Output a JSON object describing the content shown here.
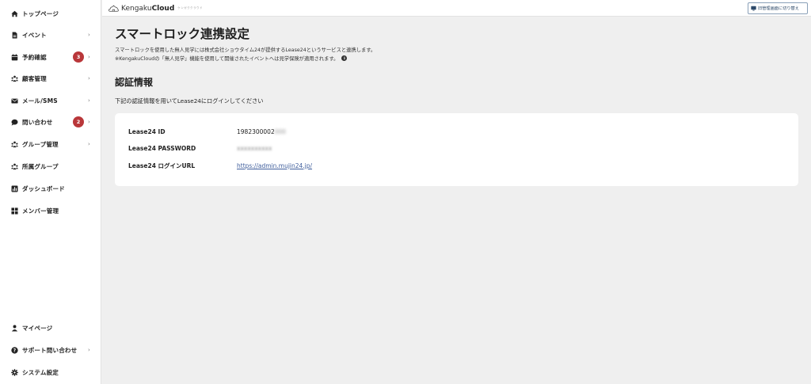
{
  "header": {
    "logo_light": "Kengaku",
    "logo_bold": "Cloud",
    "logo_sub": "ケンガククラウド",
    "switch_label": "旧管理画面に切り替え"
  },
  "sidebar": {
    "items": [
      {
        "label": "トップページ",
        "icon": "home-icon"
      },
      {
        "label": "イベント",
        "icon": "document-icon"
      },
      {
        "label": "予約確認",
        "icon": "calendar-icon",
        "badge": "3"
      },
      {
        "label": "顧客管理",
        "icon": "people-icon"
      },
      {
        "label": "メール/SMS",
        "icon": "mail-icon"
      },
      {
        "label": "問い合わせ",
        "icon": "chat-icon",
        "badge": "2"
      },
      {
        "label": "グループ管理",
        "icon": "group-icon"
      },
      {
        "label": "所属グループ",
        "icon": "group-icon"
      },
      {
        "label": "ダッシュボード",
        "icon": "chart-icon"
      },
      {
        "label": "メンバー管理",
        "icon": "grid-icon"
      }
    ],
    "bottom_items": [
      {
        "label": "マイページ",
        "icon": "user-icon"
      },
      {
        "label": "サポート問い合わせ",
        "icon": "help-icon"
      },
      {
        "label": "システム設定",
        "icon": "gear-icon"
      }
    ]
  },
  "main": {
    "title": "スマートロック連携設定",
    "description_line1": "スマートロックを使用した無人見学には株式会社ショウタイム24が提供するLease24というサービスと連携します。",
    "description_line2": "※KengakuCloudの「無人見学」機能を使用して開催されたイベントへは見学保険が適用されます。",
    "section_title": "認証情報",
    "section_desc": "下記の認証情報を用いてLease24にログインしてください",
    "credentials": {
      "id_label": "Lease24 ID",
      "id_value": "1982300002",
      "id_value_masked": "000",
      "password_label": "Lease24 PASSWORD",
      "password_value": "xxxxxxxxxx",
      "url_label": "Lease24 ログインURL",
      "url_value": "https://admin.mujin24.jp/"
    }
  },
  "colors": {
    "badge": "#b9373a",
    "link": "#3f5e9c",
    "background": "#efefef"
  }
}
